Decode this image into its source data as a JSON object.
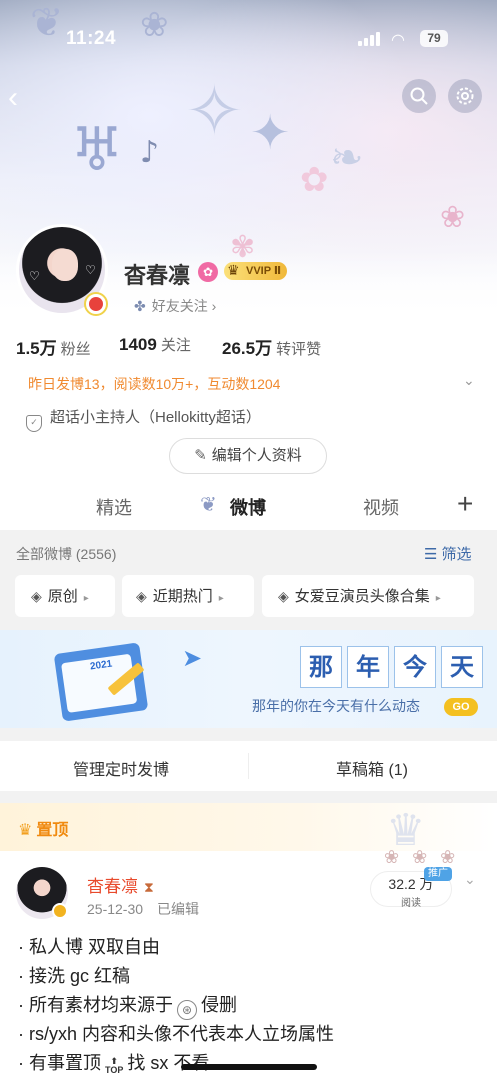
{
  "status_bar": {
    "time": "11:24",
    "battery": "79"
  },
  "profile": {
    "name": "杳春凛",
    "vip_badge": "VVIP Ⅱ",
    "friends_label": "好友关注",
    "stats": [
      {
        "value": "1.5万",
        "label": "粉丝"
      },
      {
        "value": "1409",
        "label": "关注"
      },
      {
        "value": "26.5万",
        "label": "转评赞"
      }
    ],
    "activity": "昨日发博13，阅读数10万+，互动数1204",
    "host_tag": "超话小主持人（Hellokitty超话）",
    "edit_button": "编辑个人资料"
  },
  "tabs": [
    {
      "label": "精选"
    },
    {
      "label": "微博"
    },
    {
      "label": "视频"
    }
  ],
  "filter": {
    "all_weibo": "全部微博 (2556)",
    "filter_label": "筛选",
    "chips": [
      "原创",
      "近期热门",
      "女爱豆演员头像合集"
    ]
  },
  "anniversary": {
    "chars": [
      "那",
      "年",
      "今",
      "天"
    ],
    "subtitle": "那年的你在今天有什么动态",
    "go": "GO",
    "calendar_year": "2021"
  },
  "manage": {
    "scheduled": "管理定时发博",
    "drafts": "草稿箱 (1)"
  },
  "post": {
    "pinned_label": "置顶",
    "author": "杳春凛",
    "date": "25-12-30",
    "edited": "已编辑",
    "read_count": "32.2 万",
    "read_label": "阅读",
    "ad_tag": "推广",
    "lines": [
      "· 私人博  双取自由",
      "· 接洗 gc 红稿",
      "· 所有素材均来源于",
      "· rs/yxh 内容和头像不代表本人立场属性",
      "· 有事置顶"
    ],
    "line3_suffix": "侵删",
    "line5_mid": "找 sx 不看",
    "top_icon_text": "TOP"
  },
  "colors": {
    "accent_orange": "#f08a30",
    "link_blue": "#3e6aa8",
    "name_red": "#e84a2c"
  }
}
